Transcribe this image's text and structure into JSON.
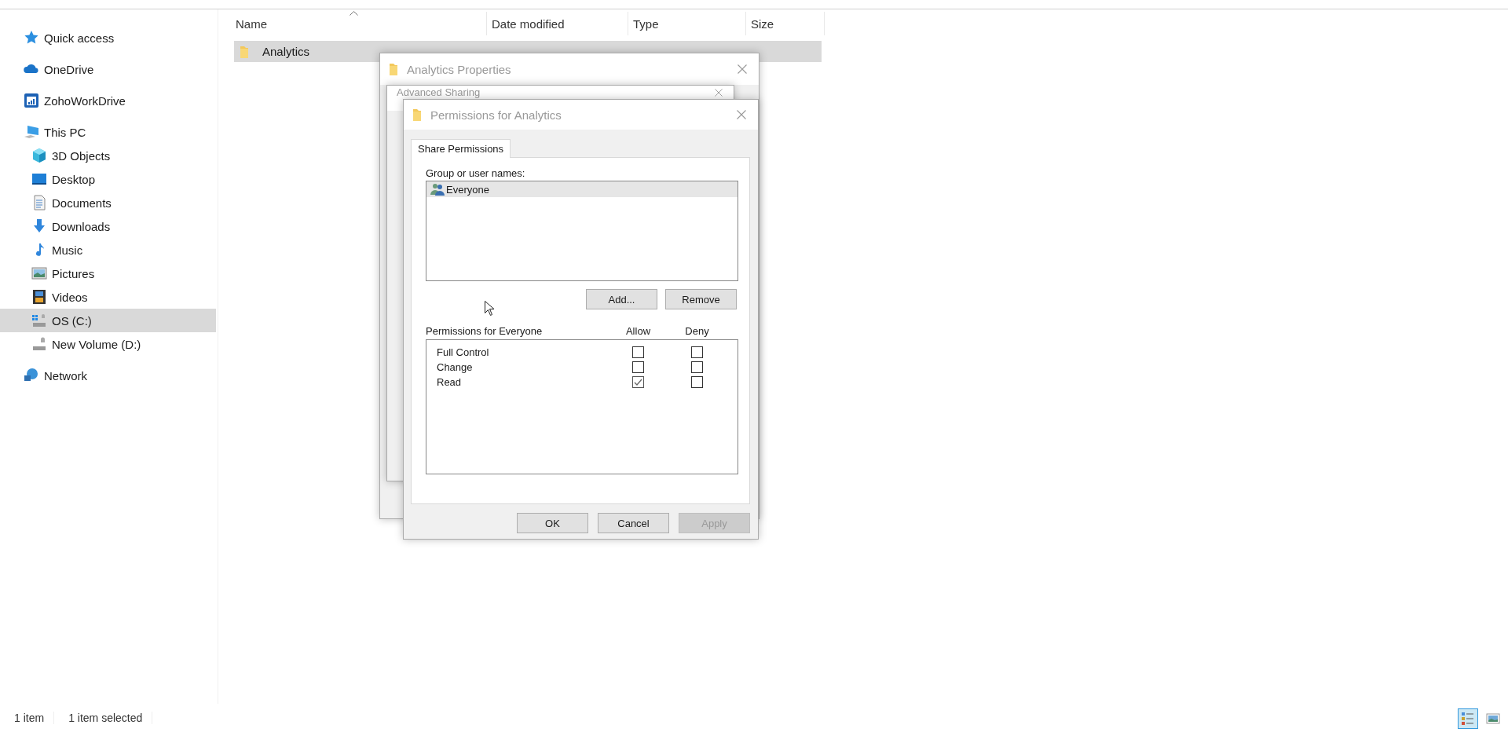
{
  "sidebar": {
    "items": [
      {
        "label": "Quick access",
        "selected": false
      },
      {
        "label": "OneDrive",
        "selected": false
      },
      {
        "label": "ZohoWorkDrive",
        "selected": false
      },
      {
        "label": "This PC",
        "selected": false,
        "children": [
          {
            "label": "3D Objects",
            "selected": false
          },
          {
            "label": "Desktop",
            "selected": false
          },
          {
            "label": "Documents",
            "selected": false
          },
          {
            "label": "Downloads",
            "selected": false
          },
          {
            "label": "Music",
            "selected": false
          },
          {
            "label": "Pictures",
            "selected": false
          },
          {
            "label": "Videos",
            "selected": false
          },
          {
            "label": "OS (C:)",
            "selected": true
          },
          {
            "label": "New Volume (D:)",
            "selected": false
          }
        ]
      },
      {
        "label": "Network",
        "selected": false
      }
    ]
  },
  "file_list": {
    "columns": [
      "Name",
      "Date modified",
      "Type",
      "Size"
    ],
    "rows": [
      {
        "name": "Analytics",
        "selected": true
      }
    ]
  },
  "properties_window": {
    "title": "Analytics Properties"
  },
  "advanced_sharing_window": {
    "title": "Advanced Sharing"
  },
  "permissions_window": {
    "title": "Permissions for Analytics",
    "tabs": [
      {
        "label": "Share Permissions",
        "selected": true
      }
    ],
    "group_label": "Group or user names:",
    "users": [
      {
        "name": "Everyone",
        "selected": true
      }
    ],
    "user_buttons": [
      "Add...",
      "Remove"
    ],
    "permissions_label": "Permissions for Everyone",
    "permission_columns": [
      "Allow",
      "Deny"
    ],
    "permissions": [
      {
        "name": "Full Control",
        "allow": false,
        "deny": false
      },
      {
        "name": "Change",
        "allow": false,
        "deny": false
      },
      {
        "name": "Read",
        "allow": true,
        "deny": false
      }
    ],
    "buttons": [
      {
        "label": "OK",
        "disabled": false
      },
      {
        "label": "Cancel",
        "disabled": false
      },
      {
        "label": "Apply",
        "disabled": true
      }
    ]
  },
  "status_bar": {
    "texts": [
      "1 item",
      "1 item selected"
    ],
    "view_buttons": [
      {
        "kind": "details",
        "selected": true
      },
      {
        "kind": "tiles",
        "selected": false
      }
    ]
  }
}
